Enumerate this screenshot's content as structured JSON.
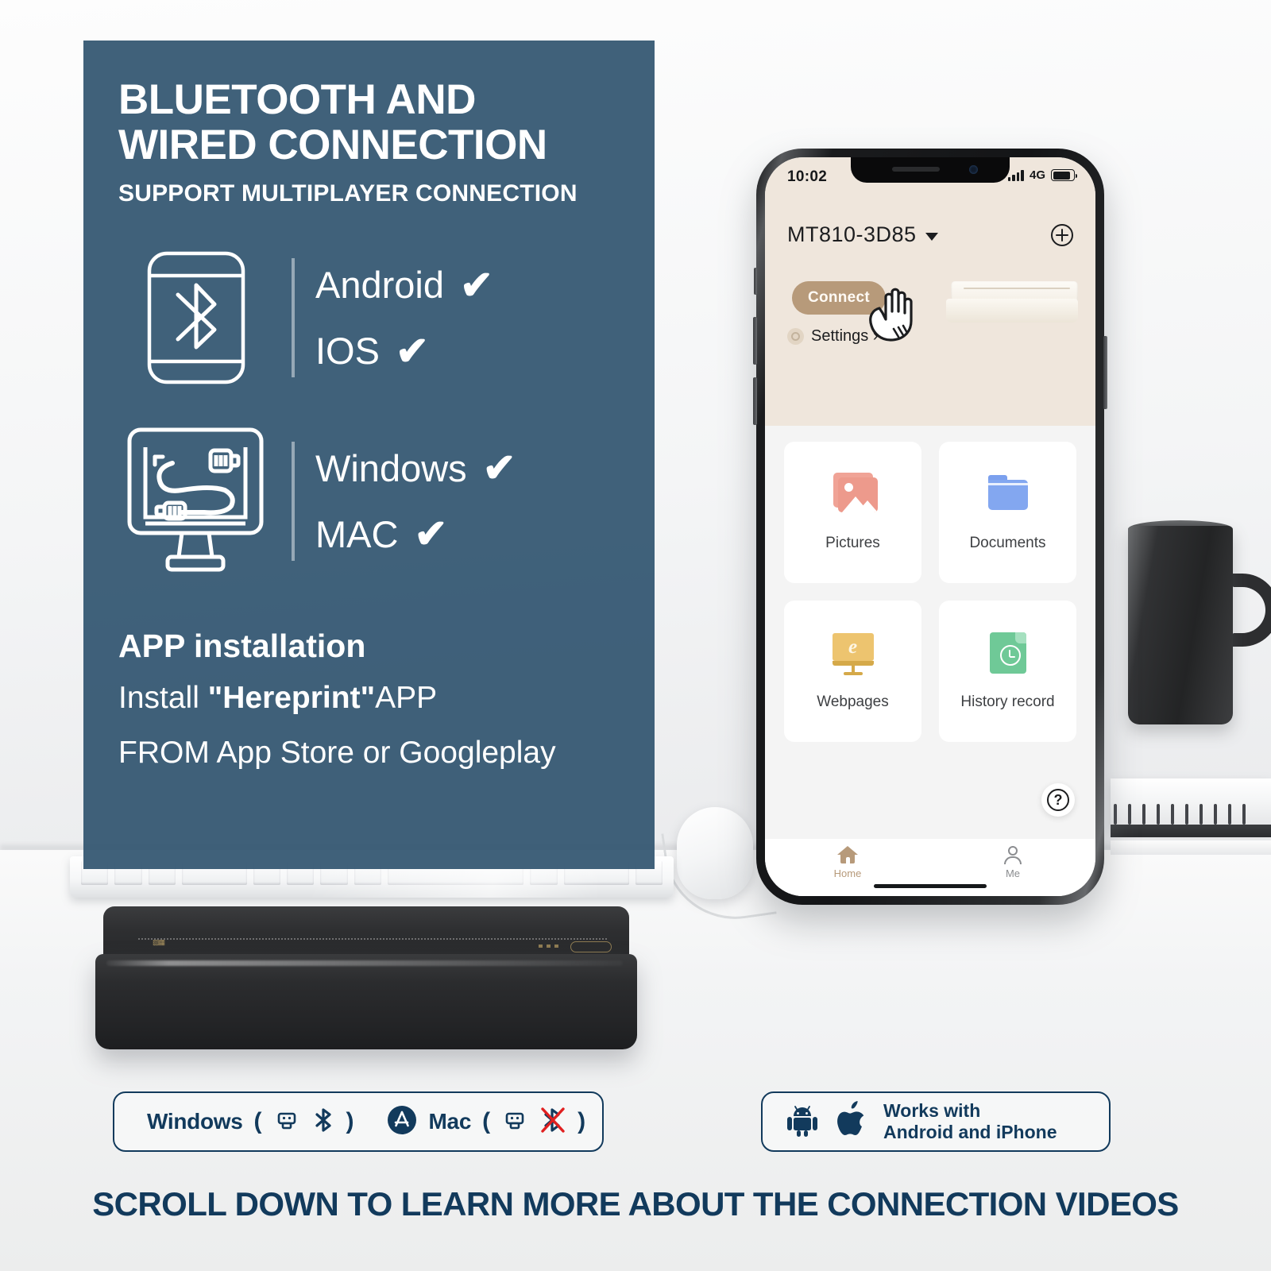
{
  "panel": {
    "title_line1": "BLUETOOTH AND",
    "title_line2": "WIRED CONNECTION",
    "subtitle": "SUPPORT MULTIPLAYER CONNECTION",
    "mobile_group": {
      "icon": "phone-bluetooth-icon",
      "items": [
        {
          "label": "Android",
          "check": "✔"
        },
        {
          "label": "IOS",
          "check": "✔"
        }
      ]
    },
    "desktop_group": {
      "icon": "monitor-usb-cable-icon",
      "items": [
        {
          "label": "Windows",
          "check": "✔"
        },
        {
          "label": "MAC",
          "check": "✔"
        }
      ]
    },
    "install": {
      "heading": "APP installation",
      "line1_prefix": "Install ",
      "line1_app": "\"Hereprint\"",
      "line1_suffix": "APP",
      "line2": "FROM App Store or Googleplay"
    }
  },
  "phone": {
    "status": {
      "time": "10:02",
      "network": "4G"
    },
    "header": {
      "device_name": "MT810-3D85",
      "connect_label": "Connect",
      "settings_label": "Settings ›",
      "add_icon": "plus-circle-icon",
      "printer_preview_icon": "white-printer-illustration"
    },
    "tiles": [
      {
        "label": "Pictures",
        "icon": "image-icon",
        "color": "#ed9a8c"
      },
      {
        "label": "Documents",
        "icon": "folder-icon",
        "color": "#83a7f0"
      },
      {
        "label": "Webpages",
        "icon": "browser-monitor-icon",
        "color": "#edc46f"
      },
      {
        "label": "History record",
        "icon": "file-clock-icon",
        "color": "#6fc997"
      }
    ],
    "help_label": "?",
    "tabs": [
      {
        "label": "Home",
        "icon": "home-icon",
        "active": true
      },
      {
        "label": "Me",
        "icon": "person-icon",
        "active": false
      }
    ]
  },
  "badges": {
    "desktop": {
      "windows_logo": "windows-logo-icon",
      "windows_label": "Windows",
      "windows_usb": "usb-icon",
      "windows_bluetooth": "bluetooth-icon",
      "appstore_logo": "app-store-logo-icon",
      "mac_label": "Mac",
      "mac_usb": "usb-icon",
      "mac_bluetooth": "bluetooth-disabled-icon",
      "open_paren": "(",
      "close_paren": ")"
    },
    "mobile": {
      "android_logo": "android-logo-icon",
      "apple_logo": "apple-logo-icon",
      "line1": "Works with",
      "line2": "Android and iPhone"
    }
  },
  "footer": {
    "cta": "SCROLL DOWN TO LEARN MORE ABOUT THE CONNECTION VIDEOS"
  },
  "colors": {
    "panel_blue": "#325570",
    "brand_navy": "#123a5c",
    "app_beige": "#efe6dc",
    "accent_tan": "#b79a7a",
    "strike_red": "#e02020"
  }
}
